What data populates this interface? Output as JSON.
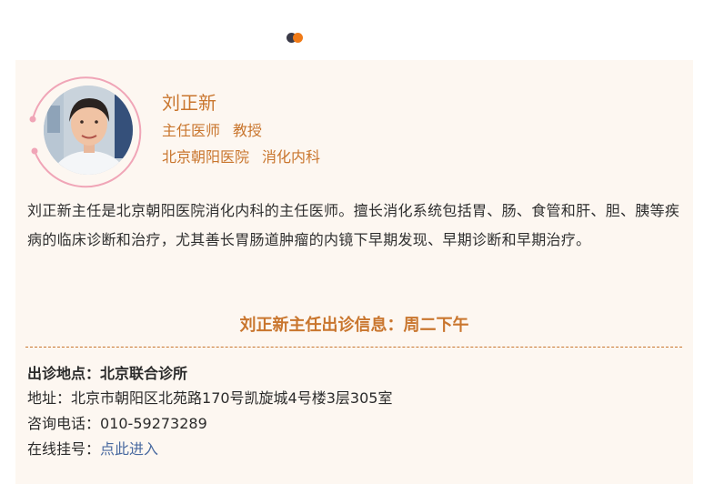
{
  "doctor": {
    "name": "刘正新",
    "title": "主任医师",
    "rank": "教授",
    "hospital": "北京朝阳医院",
    "department": "消化内科",
    "bio": "刘正新主任是北京朝阳医院消化内科的主任医师。擅长消化系统包括胃、肠、食管和肝、胆、胰等疾病的临床诊断和治疗，尤其善长胃肠道肿瘤的内镜下早期发现、早期诊断和早期治疗。"
  },
  "clinic": {
    "heading": "刘正新主任出诊信息：周二下午",
    "location_label": "出诊地点：",
    "location": "北京联合诊所",
    "address_label": "地址：",
    "address": "北京市朝阳区北苑路170号凯旋城4号楼3层305室",
    "phone_label": "咨询电话：",
    "phone": "010-59273289",
    "register_label": "在线挂号：",
    "register_link": "点此进入"
  },
  "colors": {
    "accent": "#c9762e",
    "card_bg": "#fdf7f1",
    "ring": "#f0a5b7",
    "link": "#4a6aa0"
  },
  "icons": {
    "loading": "loading-dots-icon"
  }
}
